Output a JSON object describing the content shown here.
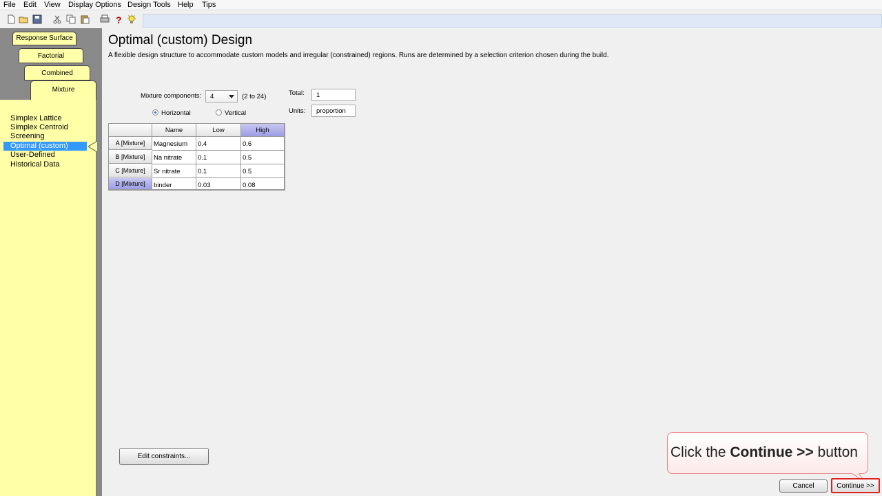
{
  "menu": [
    "File",
    "Edit",
    "View",
    "Display Options",
    "Design Tools",
    "Help",
    "Tips"
  ],
  "tabs": {
    "response_surface": "Response Surface",
    "factorial": "Factorial",
    "combined": "Combined",
    "mixture": "Mixture"
  },
  "design_types": [
    "Simplex Lattice",
    "Simplex Centroid",
    "Screening",
    "Optimal (custom)",
    "User-Defined",
    "Historical Data"
  ],
  "selected_design": "Optimal (custom)",
  "title": "Optimal (custom) Design",
  "description": "A flexible design structure to accommodate custom models and irregular (constrained) regions.  Runs are determined by a selection criterion chosen during the build.",
  "mixture_components": {
    "label": "Mixture components:",
    "value": "4",
    "range": "(2 to 24)"
  },
  "total": {
    "label": "Total:",
    "value": "1"
  },
  "units": {
    "label": "Units:",
    "value": "proportion"
  },
  "orientation": {
    "horizontal": "Horizontal",
    "vertical": "Vertical",
    "selected": "Horizontal"
  },
  "grid": {
    "headers": [
      "Name",
      "Low",
      "High"
    ],
    "rows": [
      {
        "id": "A [Mixture]",
        "name": "Magnesium",
        "low": "0.4",
        "high": "0.6"
      },
      {
        "id": "B [Mixture]",
        "name": "Na nitrate",
        "low": "0.1",
        "high": "0.5"
      },
      {
        "id": "C [Mixture]",
        "name": "Sr nitrate",
        "low": "0.1",
        "high": "0.5"
      },
      {
        "id": "D [Mixture]",
        "name": "binder",
        "low": "0.03",
        "high": "0.08"
      }
    ]
  },
  "buttons": {
    "edit_constraints": "Edit constraints...",
    "cancel": "Cancel",
    "continue": "Continue >>"
  },
  "callout": {
    "prefix": "Click the ",
    "bold": "Continue >>",
    "suffix": " button"
  },
  "colors": {
    "selection": "#3399ff",
    "panel_yellow": "#ffffa8",
    "callout_border": "#e57f7f",
    "highlight_col": "#9c9ce6"
  }
}
